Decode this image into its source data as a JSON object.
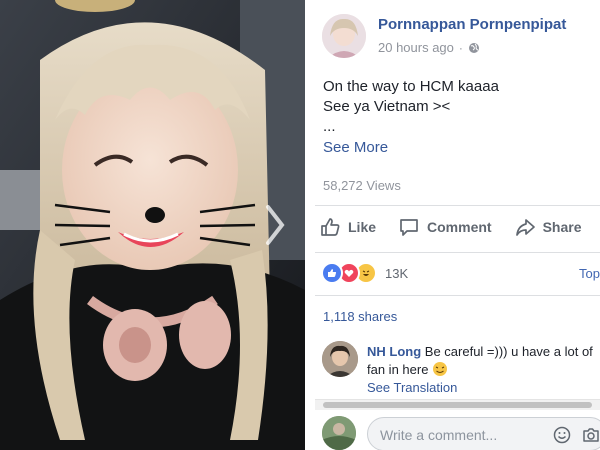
{
  "post": {
    "author": "Pornnappan Pornpenpipat",
    "time": "20 hours ago",
    "separator": "·",
    "text_lines": [
      "On the way to HCM kaaaa",
      "See ya Vietnam ><",
      "..."
    ],
    "see_more": "See More",
    "views": "58,272 Views"
  },
  "actions": {
    "like": "Like",
    "comment": "Comment",
    "share": "Share"
  },
  "reactions": {
    "count": "13K",
    "top_comments": "Top Comments",
    "shares": "1,118 shares"
  },
  "comment": {
    "author": "NH Long",
    "text": "Be careful =))) u have a lot of fan in here",
    "see_translation": "See Translation"
  },
  "compose": {
    "placeholder": "Write a comment..."
  },
  "colors": {
    "link": "#365899",
    "muted": "#90949c",
    "text": "#1d2129"
  },
  "icons": {
    "globe": "globe-icon",
    "like": "thumbs-up-icon",
    "comment": "speech-bubble-icon",
    "share": "share-arrow-icon",
    "emoji": "smiley-icon",
    "camera": "camera-icon",
    "next": "chevron-right-icon"
  }
}
